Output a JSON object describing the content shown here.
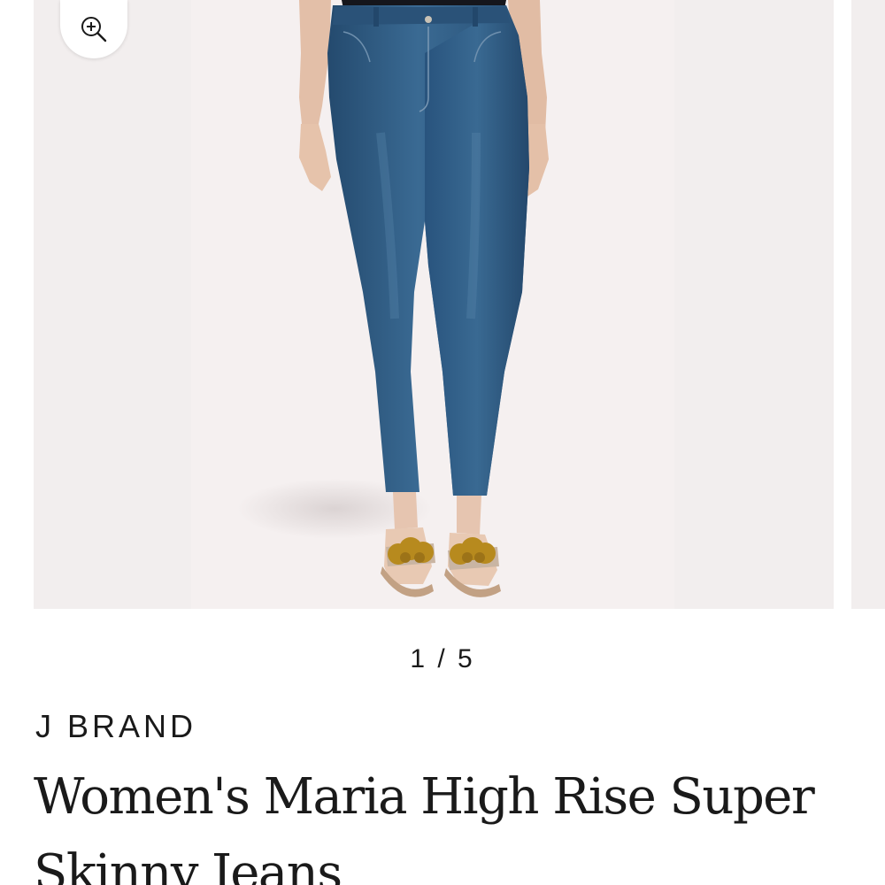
{
  "gallery": {
    "zoom_icon": "zoom-in-icon",
    "product_photo": "woman wearing skinny jeans and pom-pom slide sandals",
    "counter": "1 / 5"
  },
  "product": {
    "brand": "J BRAND",
    "title": "Women's Maria High Rise Super Skinny Jeans"
  },
  "colors": {
    "photo_background": "#f2eeee",
    "denim": "#2f5a80",
    "text": "#1a1a1a"
  }
}
